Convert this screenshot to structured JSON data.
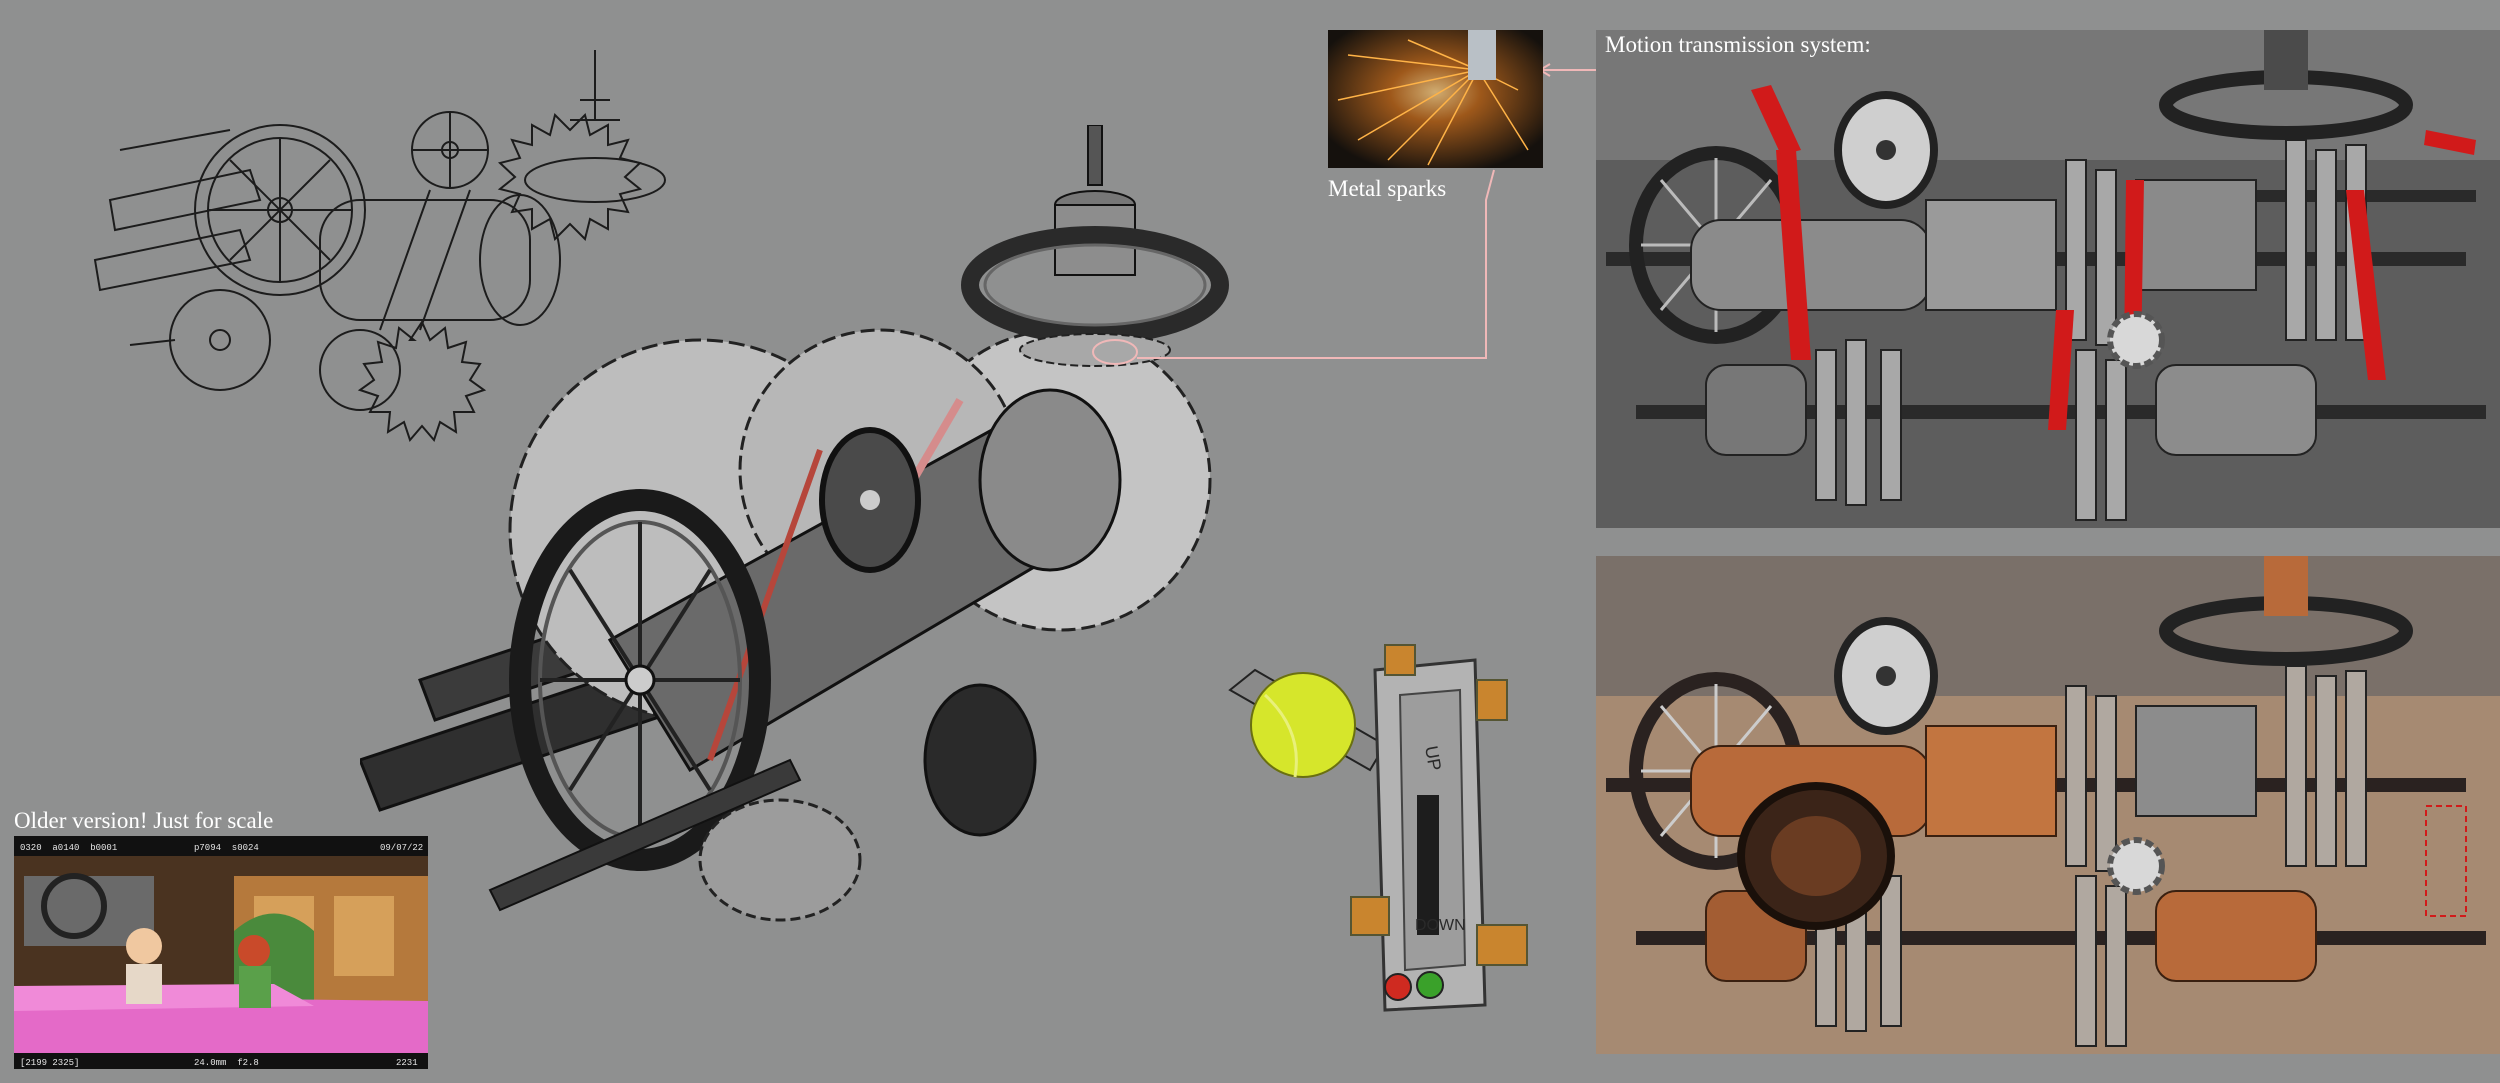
{
  "captions": {
    "metal_sparks": "Metal sparks",
    "motion_transmission": "Motion transmission system:",
    "older_version": "Older version! Just for scale"
  },
  "switch_box": {
    "label_up": "UP",
    "label_down": "DOWN"
  },
  "older_frame": {
    "top_left_codes": "0320  a0140  b0001",
    "top_mid_code": "p7094  s0024",
    "top_right_date": "09/07/22",
    "bottom_left": "[2199 2325]",
    "bottom_mid": "24.0mm  f2.8",
    "bottom_right": "2231"
  },
  "colors": {
    "background": "#8f9090",
    "callout_line": "#f0b8b8",
    "belt_red": "#d11a1a",
    "tennis_ball": "#d6e62b",
    "copper": "#b86a3a",
    "bed_pink": "#e46ac8"
  }
}
